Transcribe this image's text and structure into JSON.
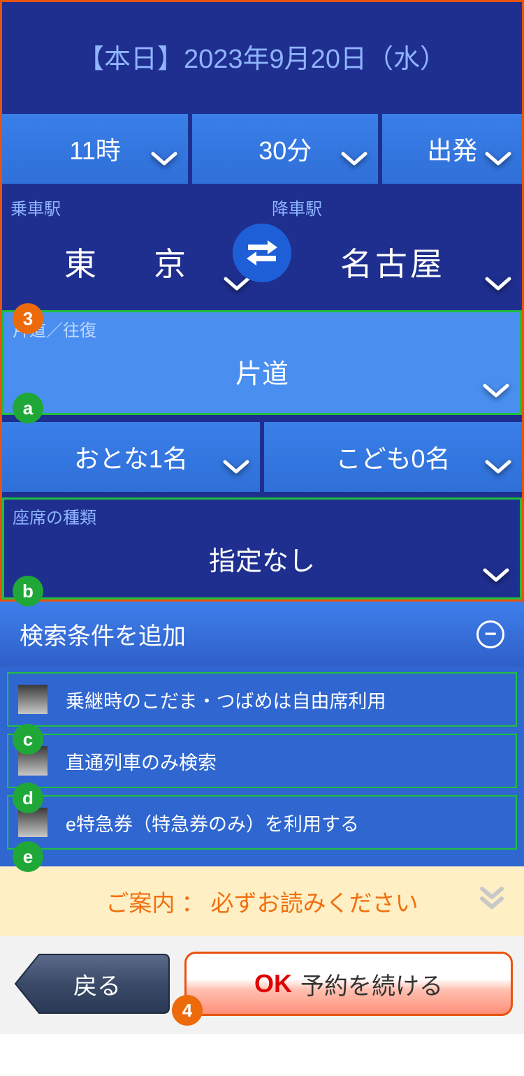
{
  "date": "【本日】2023年9月20日（水）",
  "time": {
    "hour": "11時",
    "minute": "30分",
    "depart": "出発"
  },
  "stations": {
    "from_label": "乗車駅",
    "from": "東　京",
    "to_label": "降車駅",
    "to": "名古屋"
  },
  "trip_type": {
    "label": "片道／往復",
    "value": "片道"
  },
  "passengers": {
    "adult": "おとな1名",
    "child": "こども0名"
  },
  "seat_type": {
    "label": "座席の種類",
    "value": "指定なし"
  },
  "add_conditions": {
    "header": "検索条件を追加",
    "items": [
      "乗継時のこだま・つばめは自由席利用",
      "直通列車のみ検索",
      "e特急券（特急券のみ）を利用する"
    ]
  },
  "notice": "ご案内 ： 必ずお読みください",
  "buttons": {
    "back": "戻る",
    "ok_prefix": "OK",
    "ok_text": "予約を続ける"
  },
  "annotations": {
    "n3": "3",
    "n4": "4",
    "a": "a",
    "b": "b",
    "c": "c",
    "d": "d",
    "e": "e"
  }
}
